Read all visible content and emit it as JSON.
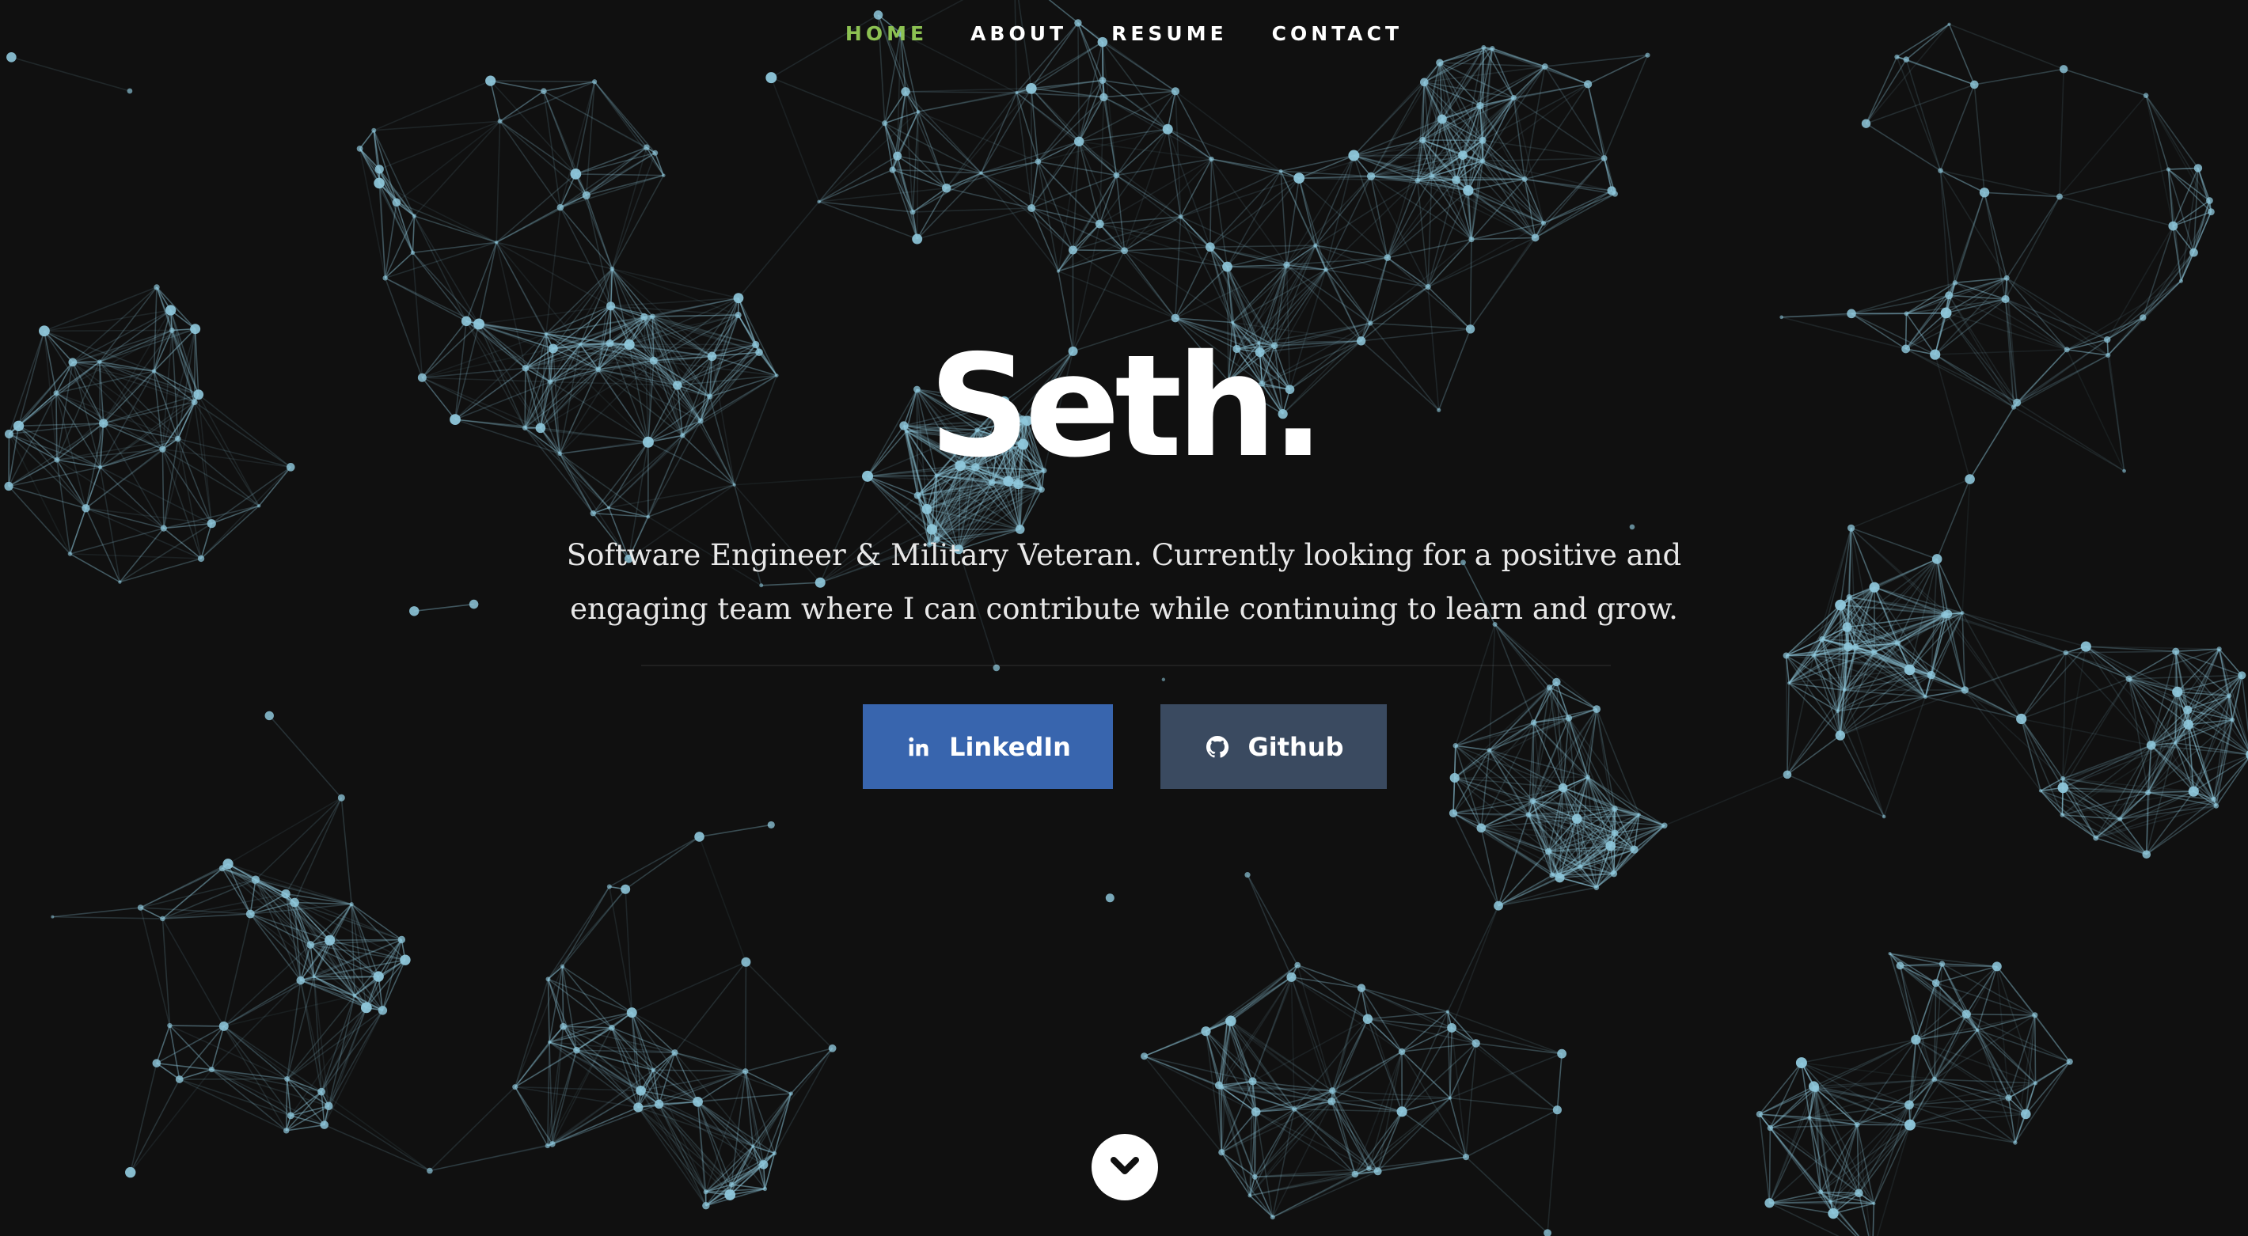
{
  "nav": {
    "items": [
      {
        "label": "HOME",
        "active": true
      },
      {
        "label": "ABOUT",
        "active": false
      },
      {
        "label": "RESUME",
        "active": false
      },
      {
        "label": "CONTACT",
        "active": false
      }
    ]
  },
  "hero": {
    "title": "Seth.",
    "description": "Software Engineer & Military Veteran. Currently looking for a positive and engaging team where I can contribute while continuing to learn and grow."
  },
  "buttons": {
    "linkedin": {
      "label": "LinkedIn",
      "icon": "linkedin-icon"
    },
    "github": {
      "label": "Github",
      "icon": "github-icon"
    }
  },
  "scroll": {
    "icon": "chevron-down-icon"
  },
  "colors": {
    "background": "#101010",
    "nav_active": "#8cc152",
    "network_line": "#8fc8dc",
    "linkedin": "#3865ae",
    "github": "#3a4a60"
  }
}
